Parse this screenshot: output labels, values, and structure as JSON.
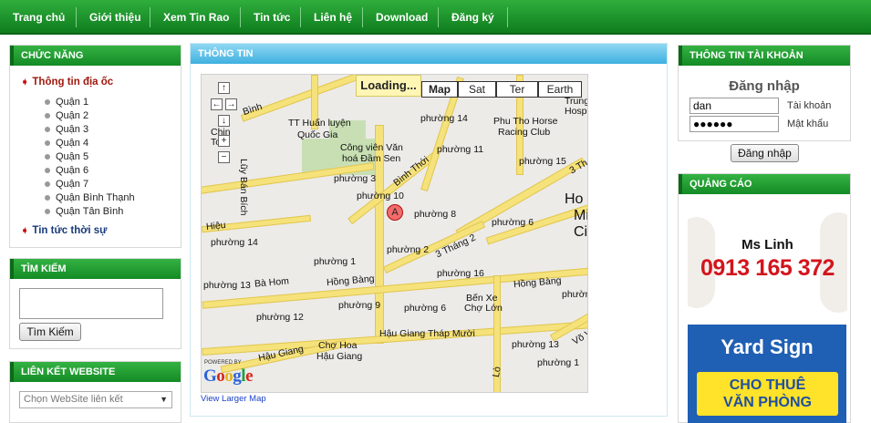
{
  "nav": {
    "items": [
      "Trang chủ",
      "Giới thiệu",
      "Xem Tin Rao",
      "Tin tức",
      "Liên hệ",
      "Download",
      "Đăng ký"
    ]
  },
  "sidebar": {
    "features_title": "CHỨC NĂNG",
    "category_main": "Thông tin địa ốc",
    "districts": [
      "Quận 1",
      "Quận 2",
      "Quận 3",
      "Quận 4",
      "Quận 5",
      "Quận 6",
      "Quận 7",
      "Quận Bình Thạnh",
      "Quận Tân Bình"
    ],
    "category_news": "Tin tức thời sự",
    "search_title": "TÌM KIẾM",
    "search_button": "Tìm Kiếm",
    "links_title": "LIÊN KẾT WEBSITE",
    "links_select": "Chọn WebSite liên kết"
  },
  "main": {
    "title": "THÔNG TIN",
    "map": {
      "loading": "Loading...",
      "types": [
        "Map",
        "Sat",
        "Ter",
        "Earth"
      ],
      "labels": {
        "binh": "Bình",
        "tt_huan_luyen": "TT Huấn luyện",
        "quoc_gia": "Quốc Gia",
        "china": "Chin",
        "town": "Tow",
        "phuong14a": "phường 14",
        "phu_tho": "Phu Tho Horse",
        "racing": "Racing Club",
        "trung": "Trung",
        "hospit": "Hospit",
        "cong_vien": "Công viên Văn",
        "hoa_dam_sen": "hoá Đầm Sen",
        "phuong11": "phường 11",
        "phuong15": "phường 15",
        "binh_thoi": "Bình Thới",
        "phuong3": "phường 3",
        "ly_ban_bich": "Lũy Bán Bích",
        "phuong10": "phường 10",
        "phuong8": "phường 8",
        "phuong6a": "phường 6",
        "ho": "Ho",
        "mi": "Mi",
        "ci": "Ci",
        "hieu": "Hiệu",
        "phuong14b": "phường 14",
        "phuong2": "phường 2",
        "three_thang_2": "3 Tháng 2",
        "three_thang_2b": "3 Th",
        "phuong1": "phường 1",
        "phuong16": "phường 16",
        "hong_bang": "Hồng Bàng",
        "hong_bang2": "Hồng Bàng",
        "ba_hom": "Bà Hom",
        "phuong13a": "phường 13",
        "phuong9": "phường 9",
        "ben_xe": "Bến Xe",
        "cho_lon": "Chợ Lớn",
        "phuong6b": "phường 6",
        "phuong12": "phường 12",
        "phuong13b": "phường 13",
        "hau_giang": "Hậu Giang",
        "thap_muoi": "Tháp Mười",
        "cho_hoa": "Chợ Hoa",
        "hau_giang2": "Hậu Giang",
        "hau_giang3": "Hậu Giang",
        "phuong13c": "phường 13",
        "phuong1b": "phường 1",
        "vo": "Võ V",
        "long": "Lò",
        "powered_by": "POWERED BY",
        "marker": "A"
      },
      "view_larger": "View Larger Map"
    }
  },
  "account": {
    "title": "THÔNG TIN TÀI KHOẢN",
    "login_heading": "Đăng nhập",
    "username_value": "dan",
    "username_label": "Tài khoản",
    "password_value": "●●●●●●",
    "password_label": "Mật khẩu",
    "login_button": "Đăng nhập"
  },
  "ads": {
    "title": "QUẢNG CÁO",
    "ad1_name": "Ms Linh",
    "ad1_phone": "0913 165 372",
    "ad2_line1": "Yard Sign",
    "ad2_line2": "CHO THUÊ",
    "ad2_line3": "VĂN PHÒNG"
  },
  "colors": {
    "nav_green": "#148b25",
    "header_blue": "#3fb0e0",
    "phone_red": "#d3141c",
    "yard_blue": "#1f5fb4",
    "yard_yellow": "#ffe22a"
  }
}
